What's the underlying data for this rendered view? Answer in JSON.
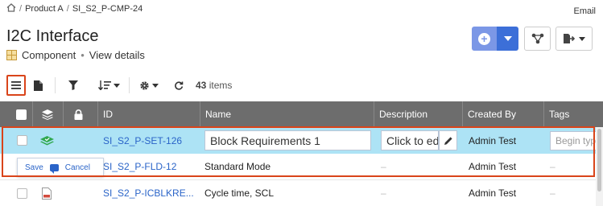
{
  "breadcrumb": {
    "items": [
      "Product A",
      "SI_S2_P-CMP-24"
    ],
    "separator": "/"
  },
  "header": {
    "email_label": "Email",
    "title": "I2C Interface",
    "type_label": "Component",
    "dot": "•",
    "view_details": "View details"
  },
  "toolbar": {
    "items_count": "43",
    "items_label": "items"
  },
  "grid": {
    "columns": [
      "ID",
      "Name",
      "Description",
      "Created By",
      "Tags"
    ],
    "rows": [
      {
        "id": "SI_S2_P-SET-126",
        "name": "Block Requirements 1",
        "description": "Click to edit",
        "created_by": "Admin Test",
        "tags": "Begin typing"
      },
      {
        "id": "SI_S2_P-FLD-12",
        "name": "Standard Mode",
        "description": "–",
        "created_by": "Admin Test",
        "tags": "–"
      },
      {
        "id": "SI_S2_P-ICBLKRE...",
        "name": "Cycle time, SCL",
        "description": "–",
        "created_by": "Admin Test",
        "tags": "–"
      }
    ]
  },
  "inline_edit": {
    "save_label": "Save",
    "cancel_label": "Cancel"
  },
  "colors": {
    "accent": "#3c6fd8",
    "highlight_row": "#ade3f5",
    "focus": "#d9441a",
    "header_bg": "#6d6d6d",
    "link": "#2a64c8"
  }
}
